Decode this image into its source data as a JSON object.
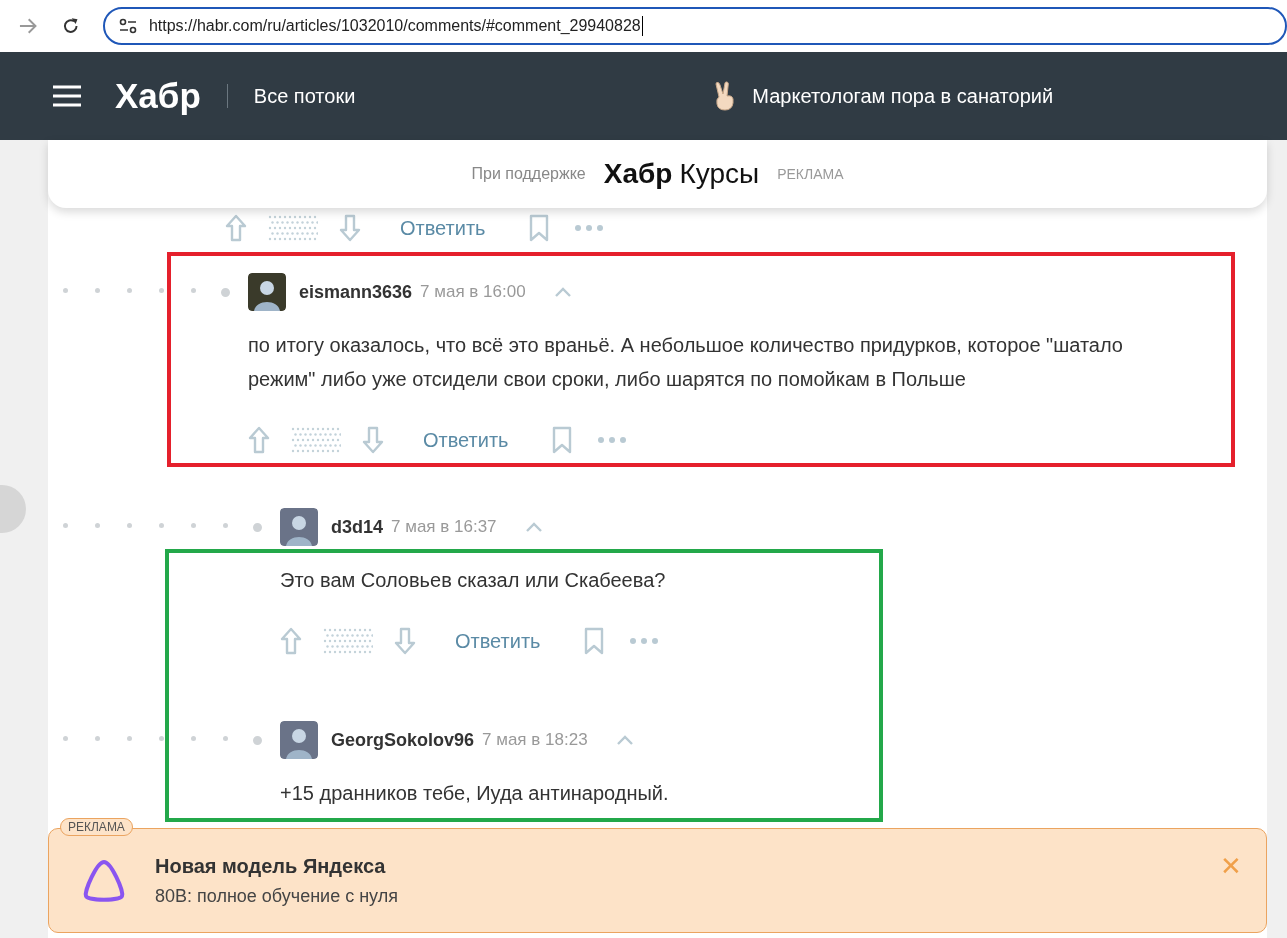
{
  "browser": {
    "url": "https://habr.com/ru/articles/1032010/comments/#comment_29940828"
  },
  "header": {
    "logo": "Хабр",
    "nav": "Все потоки",
    "promo": "Маркетологам пора в санаторий"
  },
  "support_banner": {
    "prefix": "При поддержке",
    "brand_bold": "Хабр",
    "brand_rest": "Курсы",
    "tag": "РЕКЛАМА"
  },
  "previous_actions": {
    "reply": "Ответить"
  },
  "comments": [
    {
      "author": "eismann3636",
      "date": "7 мая в 16:00",
      "text": "по итогу оказалось, что всё это враньё. А небольшое количество придурков, которое \"шатало режим\" либо уже отсидели свои сроки, либо шарятся по помойкам в Польше",
      "reply": "Ответить",
      "children": [
        {
          "author": "d3d14",
          "date": "7 мая в 16:37",
          "text": "Это вам Соловьев сказал или Скабеева?",
          "reply": "Ответить"
        },
        {
          "author": "GeorgSokolov96",
          "date": "7 мая в 18:23",
          "text": "+15 дранников тебе, Иуда антинародный."
        }
      ]
    }
  ],
  "annotations": [
    {
      "kind": "frame",
      "color": "#e5202c"
    },
    {
      "kind": "frame",
      "color": "#23a84a"
    }
  ],
  "ad": {
    "tag": "РЕКЛАМА",
    "title": "Новая модель Яндекса",
    "subtitle": "80B: полное обучение с нуля",
    "close": "✕"
  }
}
